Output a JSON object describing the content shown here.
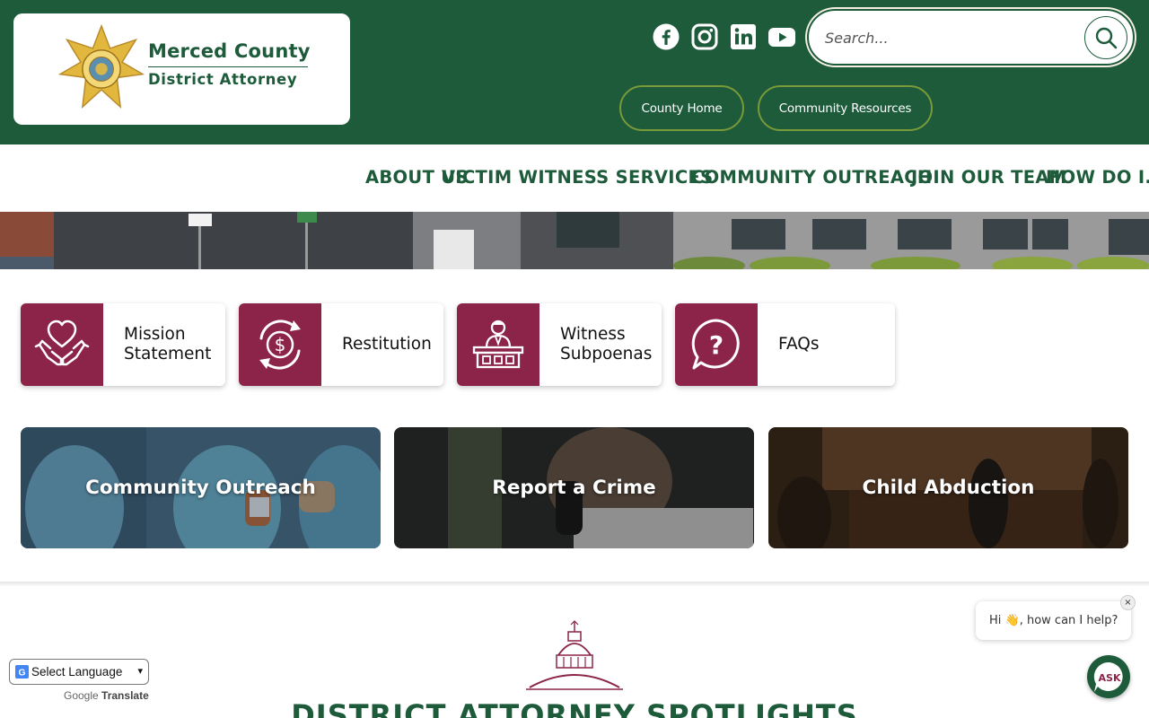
{
  "header": {
    "logo": {
      "line1": "Merced County",
      "line2": "District Attorney"
    },
    "social": [
      {
        "icon": "facebook-icon"
      },
      {
        "icon": "instagram-icon"
      },
      {
        "icon": "linkedin-icon"
      },
      {
        "icon": "youtube-icon"
      }
    ],
    "search": {
      "placeholder": "Search..."
    },
    "pills": [
      "County Home",
      "Community Resources"
    ]
  },
  "nav": {
    "items": [
      "ABOUT US",
      "VICTIM WITNESS SERVICES",
      "COMMUNITY OUTREACH",
      "JOIN OUR TEAM",
      "HOW DO I..."
    ]
  },
  "quick_links": [
    {
      "label": "Mission Statement",
      "icon": "heart-hands-icon"
    },
    {
      "label": "Restitution",
      "icon": "dollar-cycle-icon"
    },
    {
      "label": "Witness Subpoenas",
      "icon": "witness-stand-icon"
    },
    {
      "label": "FAQs",
      "icon": "question-bubble-icon"
    }
  ],
  "tiles": [
    {
      "title": "Community Outreach"
    },
    {
      "title": "Report a Crime"
    },
    {
      "title": "Child Abduction"
    }
  ],
  "spotlight": {
    "title": "DISTRICT ATTORNEY SPOTLIGHTS"
  },
  "translate": {
    "select_label": "Select Language",
    "powered_by": "Google",
    "translate_label": "Translate"
  },
  "chat": {
    "greeting": "Hi 👋, how can I help?",
    "close": "×",
    "ask_label": "ASK"
  },
  "colors": {
    "primary_green": "#1d5b3b",
    "accent_maroon": "#8c2449",
    "pill_border": "#7a9a3a"
  }
}
